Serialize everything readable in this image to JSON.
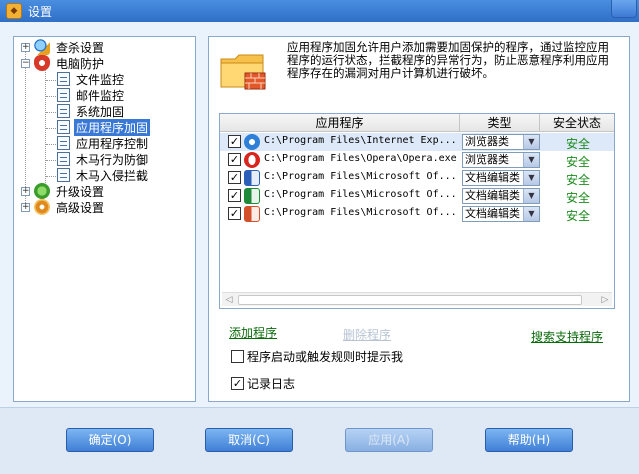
{
  "window": {
    "title": "设置"
  },
  "tree": {
    "items": [
      {
        "label": "查杀设置",
        "icon": "magnifier-icon"
      },
      {
        "label": "电脑防护",
        "icon": "shield-icon"
      },
      {
        "label": "文件监控",
        "icon": "document-icon"
      },
      {
        "label": "邮件监控",
        "icon": "document-icon"
      },
      {
        "label": "系统加固",
        "icon": "document-icon"
      },
      {
        "label": "应用程序加固",
        "icon": "document-icon",
        "selected": true
      },
      {
        "label": "应用程序控制",
        "icon": "document-icon"
      },
      {
        "label": "木马行为防御",
        "icon": "document-icon"
      },
      {
        "label": "木马入侵拦截",
        "icon": "document-icon"
      },
      {
        "label": "升级设置",
        "icon": "upgrade-icon"
      },
      {
        "label": "高级设置",
        "icon": "gear-icon"
      }
    ]
  },
  "panel": {
    "description": "应用程序加固允许用户添加需要加固保护的程序，通过监控应用程序的运行状态，拦截程序的异常行为，防止恶意程序利用应用程序存在的漏洞对用户计算机进行破坏。",
    "table": {
      "headers": [
        "应用程序",
        "类型",
        "安全状态"
      ],
      "rows": [
        {
          "checked": true,
          "icon": "ie-icon",
          "path": "C:\\Program Files\\Internet Exp...",
          "type": "浏览器类",
          "status": "安全"
        },
        {
          "checked": true,
          "icon": "opera-icon",
          "path": "C:\\Program Files\\Opera\\Opera.exe",
          "type": "浏览器类",
          "status": "安全"
        },
        {
          "checked": true,
          "icon": "word-icon",
          "path": "C:\\Program Files\\Microsoft Of...",
          "type": "文档编辑类",
          "status": "安全"
        },
        {
          "checked": true,
          "icon": "excel-icon",
          "path": "C:\\Program Files\\Microsoft Of...",
          "type": "文档编辑类",
          "status": "安全"
        },
        {
          "checked": true,
          "icon": "powerpoint-icon",
          "path": "C:\\Program Files\\Microsoft Of...",
          "type": "文档编辑类",
          "status": "安全"
        }
      ]
    },
    "links": {
      "add": "添加程序",
      "remove": "删除程序",
      "search": "搜索支持程序"
    },
    "options": {
      "notify": {
        "label": "程序启动或触发规则时提示我",
        "checked": false
      },
      "log": {
        "label": "记录日志",
        "checked": true
      }
    }
  },
  "buttons": {
    "ok": "确定(O)",
    "cancel": "取消(C)",
    "apply": "应用(A)",
    "help": "帮助(H)"
  },
  "colors": {
    "selected": "#3a78d6",
    "safe": "#1d8b1d",
    "link": "#0a6b0a",
    "button": "#3f7fd6"
  }
}
